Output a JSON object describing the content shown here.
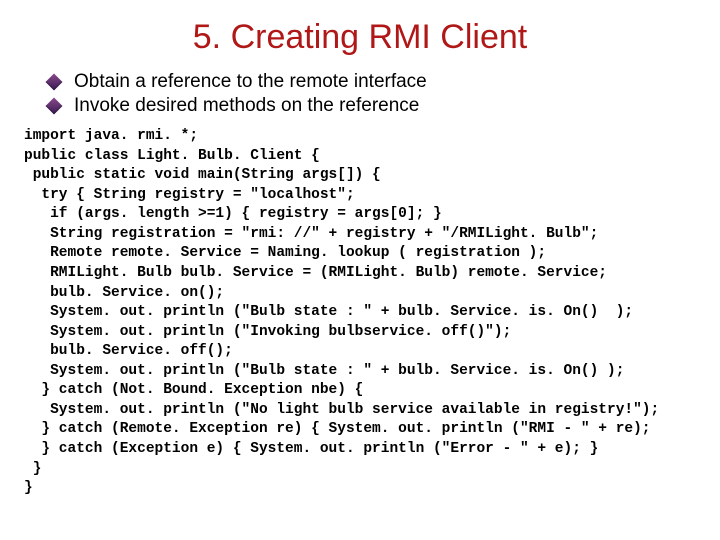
{
  "title": "5. Creating RMI Client",
  "bullets": [
    "Obtain a reference to the remote interface",
    "Invoke desired methods on the reference"
  ],
  "code_lines": [
    "import java. rmi. *;",
    "public class Light. Bulb. Client {",
    " public static void main(String args[]) {",
    "  try { String registry = \"localhost\";",
    "   if (args. length >=1) { registry = args[0]; }",
    "   String registration = \"rmi: //\" + registry + \"/RMILight. Bulb\";",
    "   Remote remote. Service = Naming. lookup ( registration );",
    "   RMILight. Bulb bulb. Service = (RMILight. Bulb) remote. Service;",
    "   bulb. Service. on();",
    "   System. out. println (\"Bulb state : \" + bulb. Service. is. On()  );",
    "   System. out. println (\"Invoking bulbservice. off()\");",
    "   bulb. Service. off();",
    "   System. out. println (\"Bulb state : \" + bulb. Service. is. On() );",
    "  } catch (Not. Bound. Exception nbe) {",
    "   System. out. println (\"No light bulb service available in registry!\");",
    "  } catch (Remote. Exception re) { System. out. println (\"RMI - \" + re);",
    "  } catch (Exception e) { System. out. println (\"Error - \" + e); }",
    " }",
    "}"
  ]
}
